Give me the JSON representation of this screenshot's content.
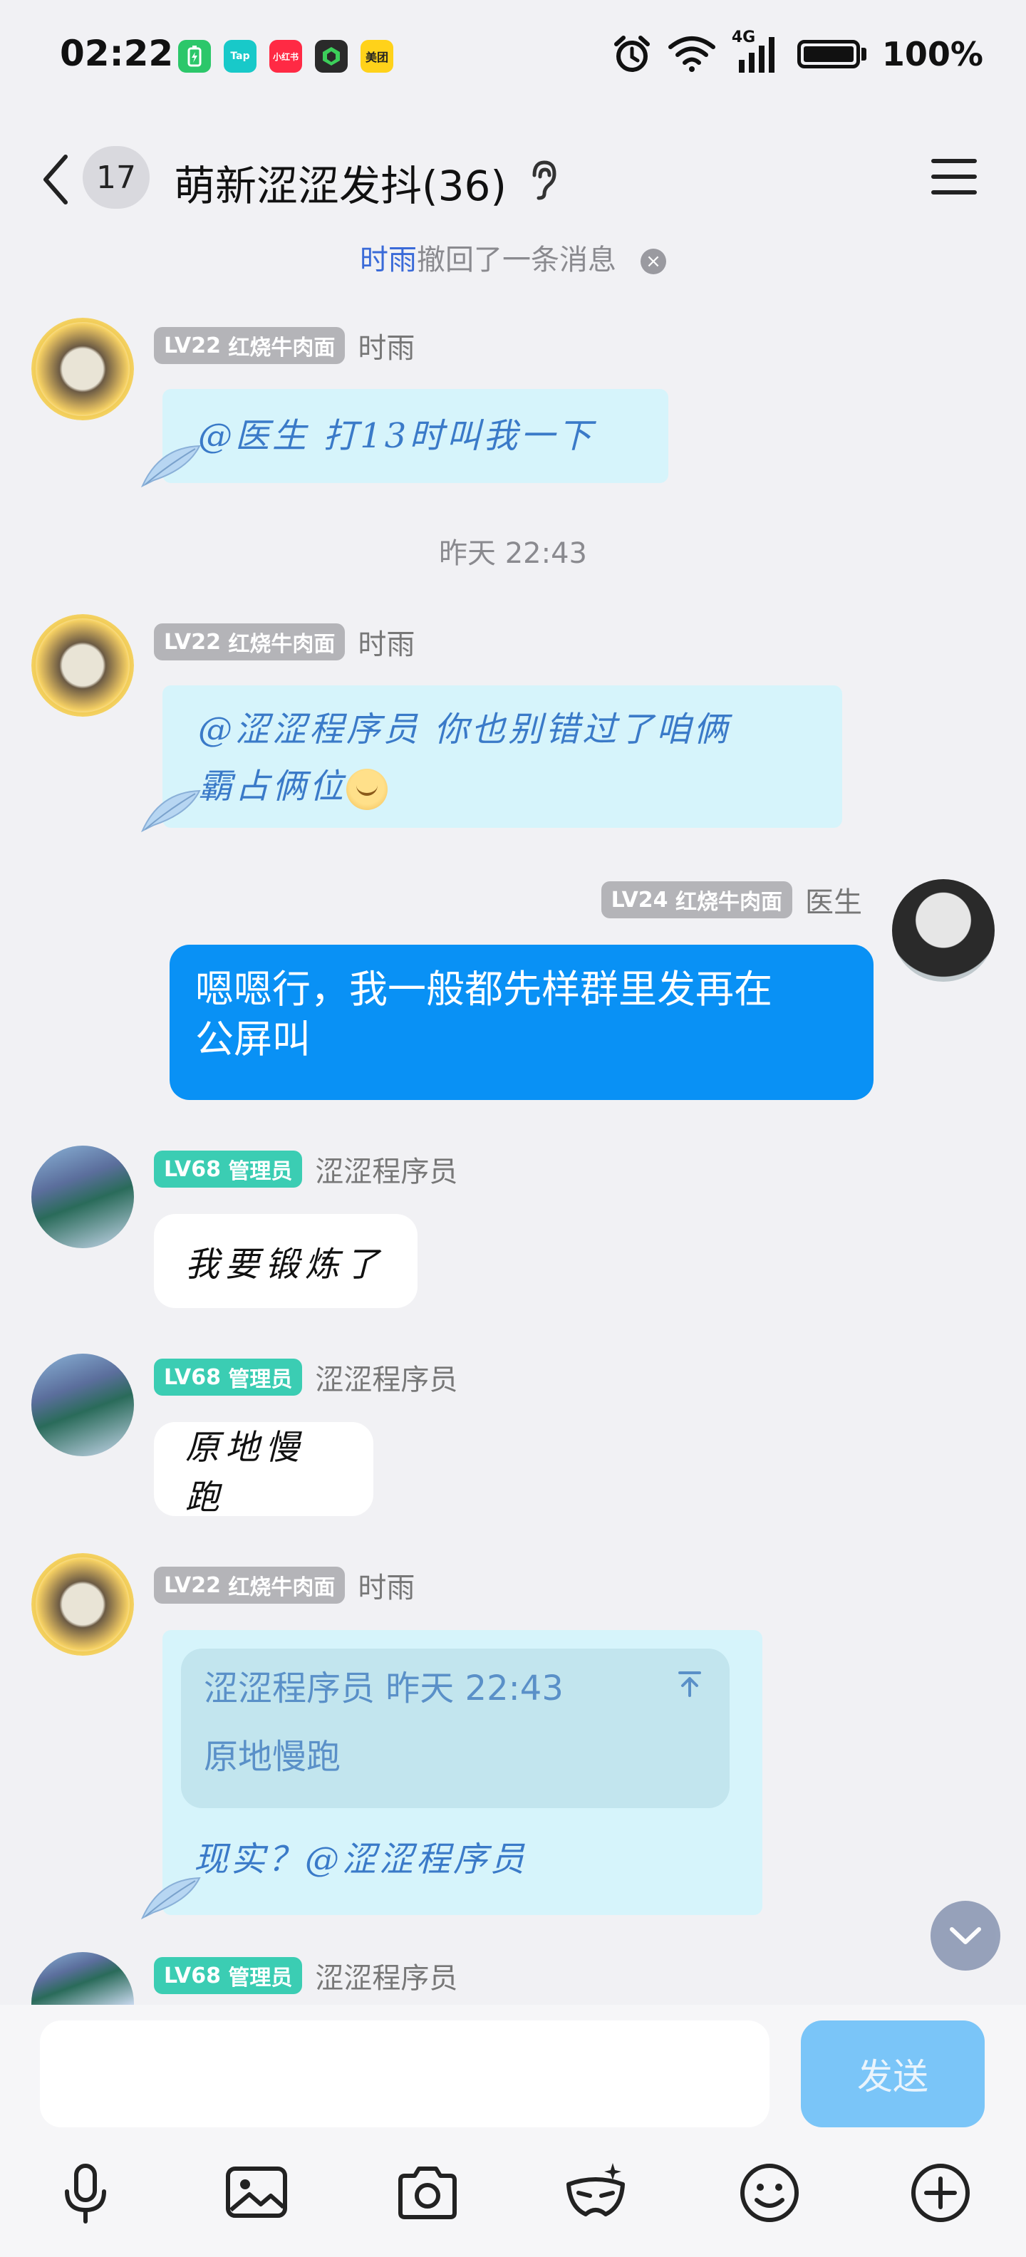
{
  "status_bar": {
    "time": "02:22",
    "apps": [
      {
        "name": "battery-saver-app-icon",
        "label": "",
        "color": "#2cc76a"
      },
      {
        "name": "taptap-app-icon",
        "label": "Tap",
        "color": "#18c9c9"
      },
      {
        "name": "xiaohongshu-app-icon",
        "label": "小红书",
        "color": "#ff2a44"
      },
      {
        "name": "shield-app-icon",
        "label": "",
        "color": "#2a2a2a"
      },
      {
        "name": "meituan-app-icon",
        "label": "美团",
        "color": "#ffd21a"
      }
    ],
    "network": "4G",
    "battery": "100%"
  },
  "header": {
    "unread_count": "17",
    "title": "萌新涩涩发抖(36)"
  },
  "recall": {
    "who": "时雨",
    "text": "撤回了一条消息"
  },
  "timestamp": "昨天 22:43",
  "messages": [
    {
      "level": "LV22",
      "title": "红烧牛肉面",
      "sender": "时雨",
      "text": "@医生 打13时叫我一下"
    },
    {
      "level": "LV22",
      "title": "红烧牛肉面",
      "sender": "时雨",
      "line1": "@涩涩程序员 你也别错过了咱俩",
      "line2": "霸占俩位"
    },
    {
      "level": "LV24",
      "title": "红烧牛肉面",
      "sender": "医生",
      "line1": "嗯嗯行，我一般都先样群里发再在",
      "line2": "公屏叫"
    },
    {
      "level": "LV68",
      "title": "管理员",
      "sender": "涩涩程序员",
      "text": "我要锻炼了"
    },
    {
      "level": "LV68",
      "title": "管理员",
      "sender": "涩涩程序员",
      "text": "原地慢跑"
    },
    {
      "level": "LV22",
      "title": "红烧牛肉面",
      "sender": "时雨",
      "quote_sender": "涩涩程序员",
      "quote_time": "昨天 22:43",
      "quote_text": "原地慢跑",
      "text": "现实？@涩涩程序员"
    },
    {
      "level": "LV68",
      "title": "管理员",
      "sender": "涩涩程序员"
    }
  ],
  "composer": {
    "placeholder": "",
    "send_label": "发送"
  },
  "colors": {
    "accent_blue": "#0991f5",
    "fancy_bubble": "#d6f4fb",
    "admin_badge": "#3bcdb3",
    "level_badge": "#b4b4b8"
  }
}
